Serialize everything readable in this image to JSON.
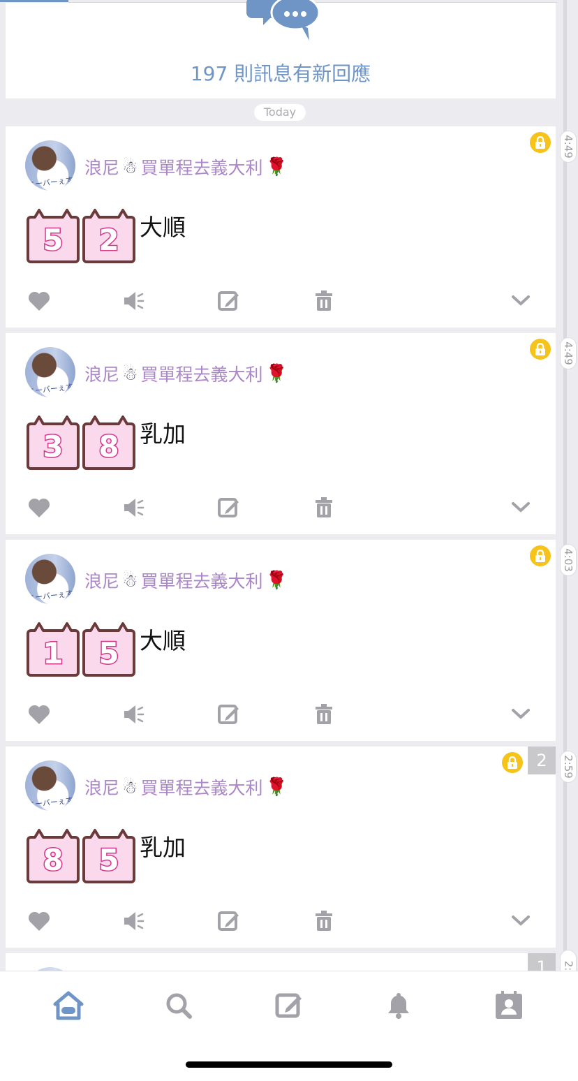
{
  "header": {
    "new_replies_text": "197 則訊息有新回應"
  },
  "day_label": "Today",
  "posts": [
    {
      "username": "浪尼",
      "group_text": "買單程去義大利",
      "snowman": "☃",
      "rose": "🌹",
      "avatar_signature": "ニーバーぇす",
      "digits": [
        "5",
        "2"
      ],
      "text": "大順",
      "time": "4:49",
      "locked": true,
      "badge": ""
    },
    {
      "username": "浪尼",
      "group_text": "買單程去義大利",
      "snowman": "☃",
      "rose": "🌹",
      "avatar_signature": "ニーバーぇす",
      "digits": [
        "3",
        "8"
      ],
      "text": "乳加",
      "time": "4:49",
      "locked": true,
      "badge": ""
    },
    {
      "username": "浪尼",
      "group_text": "買單程去義大利",
      "snowman": "☃",
      "rose": "🌹",
      "avatar_signature": "ニーバーぇす",
      "digits": [
        "1",
        "5"
      ],
      "text": "大順",
      "time": "4:03",
      "locked": true,
      "badge": ""
    },
    {
      "username": "浪尼",
      "group_text": "買單程去義大利",
      "snowman": "☃",
      "rose": "🌹",
      "avatar_signature": "ニーバーぇす",
      "digits": [
        "8",
        "5"
      ],
      "text": "乳加",
      "time": "2:59",
      "locked": true,
      "badge": "2"
    }
  ],
  "partial_post": {
    "badge": "1",
    "time": "2:"
  },
  "post_actions": [
    "heart-icon",
    "mute-icon",
    "edit-icon",
    "trash-icon",
    "chevron-down-icon"
  ],
  "tabs": [
    {
      "name": "home-icon",
      "active": true
    },
    {
      "name": "search-icon",
      "active": false
    },
    {
      "name": "compose-icon",
      "active": false
    },
    {
      "name": "bell-icon",
      "active": false
    },
    {
      "name": "profile-icon",
      "active": false
    }
  ],
  "colors": {
    "accent": "#6f95c6",
    "username": "#ab86c8",
    "lock": "#f5c31a",
    "icon_gray": "#a2a2a8",
    "digit_pink": "#d5368a",
    "digit_frame": "#6b3a3a"
  }
}
